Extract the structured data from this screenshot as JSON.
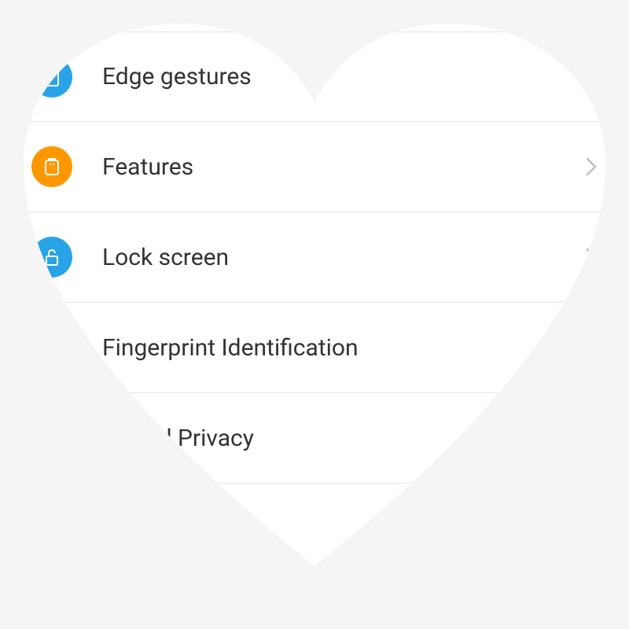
{
  "settings": {
    "items": [
      {
        "label": "Edge gestures",
        "icon": "edge-gestures-icon",
        "iconColor": "blue",
        "hasChevron": true
      },
      {
        "label": "Features",
        "icon": "features-icon",
        "iconColor": "orange",
        "hasChevron": true
      },
      {
        "label": "Lock screen",
        "icon": "lock-icon",
        "iconColor": "blue",
        "hasChevron": true
      },
      {
        "label": "Fingerprint Identification",
        "icon": null,
        "iconColor": null,
        "hasChevron": false
      },
      {
        "label": "ity and Privacy",
        "icon": null,
        "iconColor": null,
        "hasChevron": false
      }
    ]
  },
  "colors": {
    "blue": "#29a3e8",
    "orange": "#ff9800",
    "chevron": "#c0c0c0",
    "divider": "#e5e5e5"
  }
}
